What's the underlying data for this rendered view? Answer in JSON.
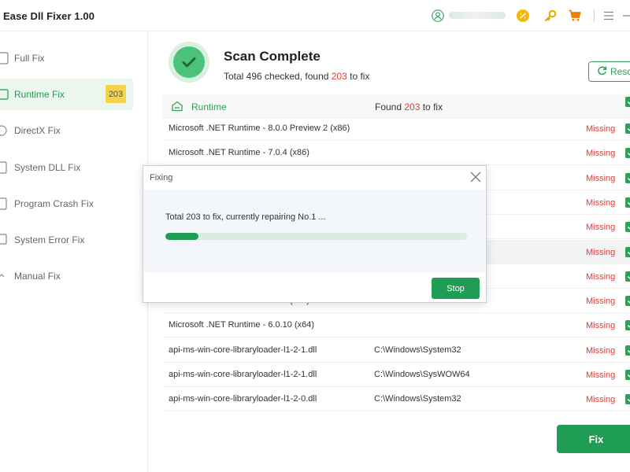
{
  "app": {
    "title": "Ease Dll Fixer  1.00"
  },
  "colors": {
    "accent": "#1f9d55",
    "missing": "#e53935",
    "badge": "#f7d34a"
  },
  "titlebar": {
    "icons": [
      "user-icon",
      "coupon-icon",
      "key-icon",
      "cart-icon",
      "menu-icon",
      "minimize-icon"
    ]
  },
  "sidebar": {
    "items": [
      {
        "label": "Full Fix",
        "icon": "full-fix-icon"
      },
      {
        "label": "Runtime Fix",
        "icon": "runtime-icon",
        "badge": "203",
        "active": true
      },
      {
        "label": "DirectX Fix",
        "icon": "directx-icon"
      },
      {
        "label": "System DLL Fix",
        "icon": "system-dll-icon"
      },
      {
        "label": "Program Crash Fix",
        "icon": "crash-icon"
      },
      {
        "label": "System Error Fix",
        "icon": "error-icon"
      },
      {
        "label": "Manual Fix",
        "icon": "manual-icon"
      }
    ]
  },
  "scan": {
    "title": "Scan Complete",
    "sub_prefix": "Total 496 checked, found ",
    "sub_count": "203",
    "sub_suffix": " to fix",
    "rescan_label": "Resca"
  },
  "table": {
    "head_label": "Runtime",
    "found_prefix": "Found ",
    "found_count": "203",
    "found_suffix": " to fix",
    "rows": [
      {
        "name": "Microsoft .NET Runtime - 8.0.0 Preview 2 (x86)",
        "path": "",
        "status": "Missing"
      },
      {
        "name": "Microsoft .NET Runtime - 7.0.4 (x86)",
        "path": "",
        "status": "Missing"
      },
      {
        "name": "",
        "path": "",
        "status": "Missing"
      },
      {
        "name": "",
        "path": "",
        "status": "Missing"
      },
      {
        "name": "",
        "path": "",
        "status": "Missing"
      },
      {
        "name": "",
        "path": "",
        "status": "Missing"
      },
      {
        "name": "",
        "path": "",
        "status": "Missing"
      },
      {
        "name": "Microsoft .NET Runtime - 7.0.4 (x64)",
        "path": "",
        "status": "Missing"
      },
      {
        "name": "Microsoft .NET Runtime - 6.0.10 (x64)",
        "path": "",
        "status": "Missing"
      },
      {
        "name": "api-ms-win-core-libraryloader-l1-2-1.dll",
        "path": "C:\\Windows\\System32",
        "status": "Missing"
      },
      {
        "name": "api-ms-win-core-libraryloader-l1-2-1.dll",
        "path": "C:\\Windows\\SysWOW64",
        "status": "Missing"
      },
      {
        "name": "api-ms-win-core-libraryloader-l1-2-0.dll",
        "path": "C:\\Windows\\System32",
        "status": "Missing"
      }
    ]
  },
  "fix_button": {
    "label": "Fix"
  },
  "dialog": {
    "title": "Fixing",
    "message": "Total 203 to fix, currently repairing No.1 ...",
    "progress_percent": 11,
    "stop_label": "Stop"
  }
}
